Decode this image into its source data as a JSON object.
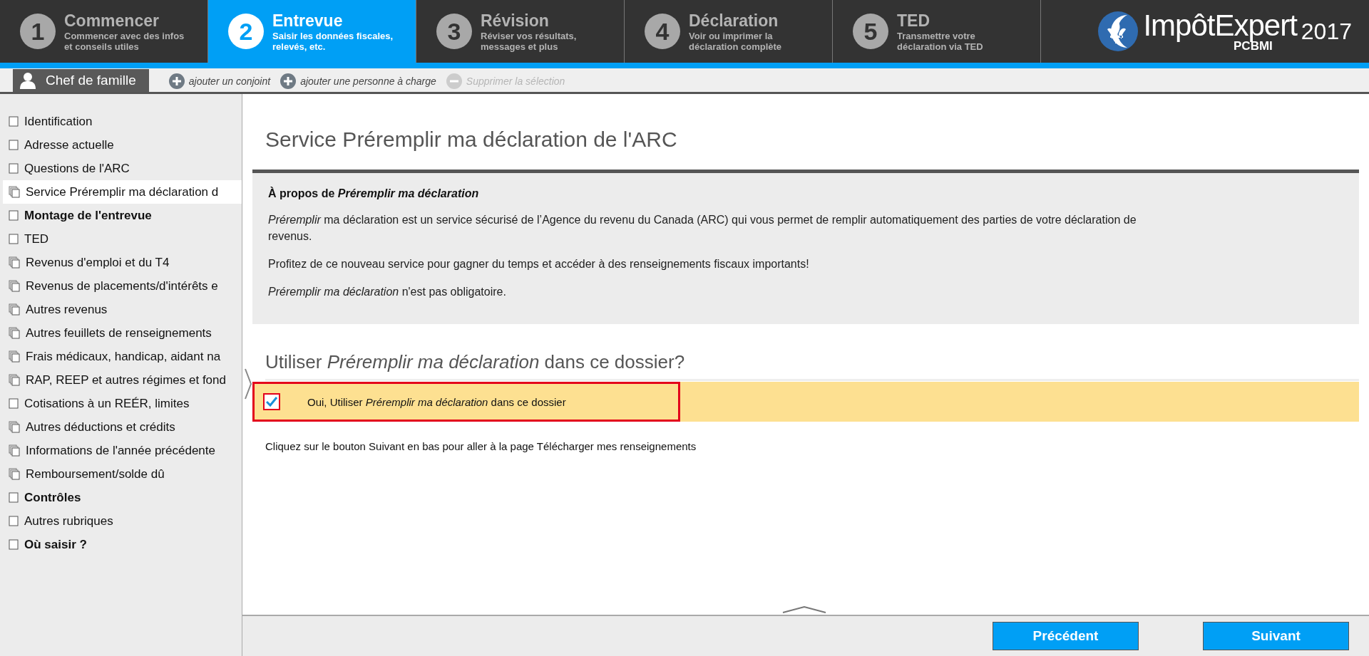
{
  "steps": [
    {
      "number": "1",
      "title": "Commencer",
      "subtitle": [
        "Commencer avec des infos",
        "et conseils utiles"
      ],
      "selected": false
    },
    {
      "number": "2",
      "title": "Entrevue",
      "subtitle": [
        "Saisir les données fiscales,",
        "relevés, etc."
      ],
      "selected": true
    },
    {
      "number": "3",
      "title": "Révision",
      "subtitle": [
        "Réviser vos résultats,",
        "messages et plus"
      ],
      "selected": false
    },
    {
      "number": "4",
      "title": "Déclaration",
      "subtitle": [
        "Voir ou imprimer la",
        "déclaration complète"
      ],
      "selected": false
    },
    {
      "number": "5",
      "title": "TED",
      "subtitle": [
        "Transmettre votre",
        "déclaration via TED"
      ],
      "selected": false
    }
  ],
  "logo": {
    "name": "ImpôtExpert",
    "sub": "PCBMI",
    "year": "2017"
  },
  "person_tab": "Chef de famille",
  "actions": [
    {
      "label": "ajouter un conjoint",
      "kind": "add",
      "disabled": false
    },
    {
      "label": "ajouter une personne à charge",
      "kind": "add",
      "disabled": false
    },
    {
      "label": "Supprimer la sélection",
      "kind": "remove",
      "disabled": true
    }
  ],
  "sidebar": {
    "items": [
      {
        "label": "Identification",
        "kind": "single",
        "bold": false,
        "selected": false
      },
      {
        "label": "Adresse actuelle",
        "kind": "single",
        "bold": false,
        "selected": false
      },
      {
        "label": "Questions de l'ARC",
        "kind": "single",
        "bold": false,
        "selected": false
      },
      {
        "label": "Service Préremplir ma déclaration d",
        "kind": "multi",
        "bold": false,
        "selected": true
      },
      {
        "label": "Montage de l'entrevue",
        "kind": "single",
        "bold": true,
        "selected": false
      },
      {
        "label": "TED",
        "kind": "single",
        "bold": false,
        "selected": false
      },
      {
        "label": "Revenus d'emploi et du T4",
        "kind": "multi",
        "bold": false,
        "selected": false
      },
      {
        "label": "Revenus de placements/d'intérêts e",
        "kind": "multi",
        "bold": false,
        "selected": false
      },
      {
        "label": "Autres revenus",
        "kind": "multi",
        "bold": false,
        "selected": false
      },
      {
        "label": "Autres feuillets de renseignements",
        "kind": "multi",
        "bold": false,
        "selected": false
      },
      {
        "label": "Frais médicaux, handicap, aidant na",
        "kind": "multi",
        "bold": false,
        "selected": false
      },
      {
        "label": "RAP, REEP et autres régimes et fond",
        "kind": "multi",
        "bold": false,
        "selected": false
      },
      {
        "label": "Cotisations à un REÉR, limites",
        "kind": "single",
        "bold": false,
        "selected": false
      },
      {
        "label": "Autres déductions et crédits",
        "kind": "multi",
        "bold": false,
        "selected": false
      },
      {
        "label": "Informations de l'année précédente",
        "kind": "multi",
        "bold": false,
        "selected": false
      },
      {
        "label": "Remboursement/solde dû",
        "kind": "multi",
        "bold": false,
        "selected": false
      },
      {
        "label": "Contrôles",
        "kind": "single",
        "bold": true,
        "selected": false
      },
      {
        "label": "Autres rubriques",
        "kind": "single",
        "bold": false,
        "selected": false
      },
      {
        "label": "Où saisir ?",
        "kind": "single",
        "bold": true,
        "selected": false
      }
    ]
  },
  "page": {
    "title": "Service Préremplir ma déclaration de l'ARC",
    "info": {
      "heading": "À propos de *Préremplir ma déclaration*",
      "paragraphs": [
        "*Préremplir* ma déclaration est un service sécurisé de l’Agence du revenu du Canada (ARC) qui vous permet de remplir automatiquement des parties de votre déclaration de revenus.",
        "Profitez de ce nouveau service pour gagner du temps et accéder à des renseignements fiscaux importants!",
        "*Préremplir ma déclaration* n'est pas obligatoire."
      ]
    },
    "question": "Utiliser *Préremplir ma déclaration* dans ce dossier?",
    "option": {
      "label": "Oui, Utiliser *Préremplir ma déclaration* dans ce dossier",
      "checked": true
    },
    "hint": "Cliquez sur le bouton Suivant en bas pour aller à la page Télécharger mes renseignements"
  },
  "buttons": [
    "Précédent",
    "Suivant"
  ]
}
